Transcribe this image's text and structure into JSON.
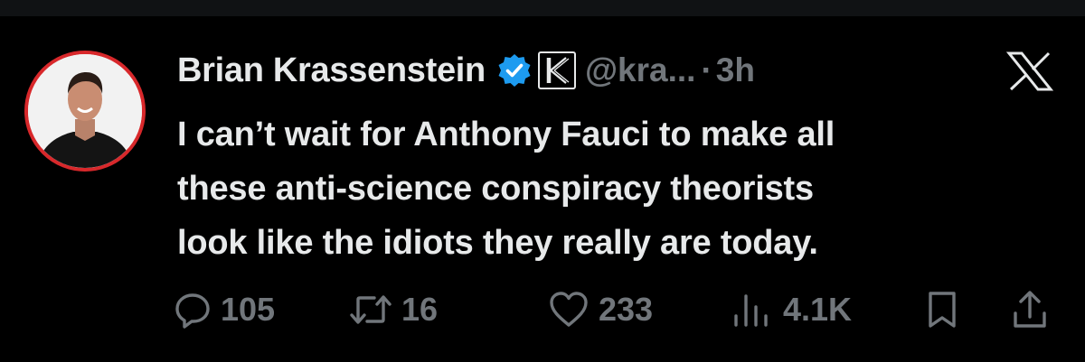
{
  "tweet": {
    "author_name": "Brian Krassenstein",
    "handle": "@kra...",
    "separator": "·",
    "time_ago": "3h",
    "affiliation_badge_letter": "K",
    "text_lines": [
      "I can’t wait for Anthony Fauci to make all",
      "these anti-science conspiracy theorists",
      "look like the idiots they really are today."
    ]
  },
  "stats": {
    "replies": "105",
    "retweets": "16",
    "likes": "233",
    "views": "4.1K"
  },
  "icons": {
    "verified": "verified-badge-icon",
    "platform": "x-logo-icon",
    "reply": "reply-icon",
    "retweet": "retweet-icon",
    "like": "like-icon",
    "views": "views-icon",
    "bookmark": "bookmark-icon",
    "share": "share-icon"
  },
  "colors": {
    "background": "#000000",
    "text_primary": "#e7e9ea",
    "text_secondary": "#71767b",
    "verified_blue": "#1d9bf0",
    "avatar_ring": "#d8282b"
  }
}
